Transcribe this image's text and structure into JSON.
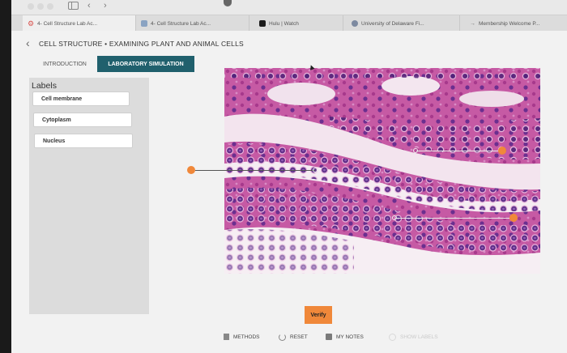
{
  "browser": {
    "tabs": [
      {
        "title": "4- Cell Structure Lab Ac...",
        "favicon": "gear-icon"
      },
      {
        "title": "4- Cell Structure Lab Ac...",
        "favicon": "page-icon"
      },
      {
        "title": "Hulu | Watch",
        "favicon": "hulu-icon"
      },
      {
        "title": "University of Delaware Fi...",
        "favicon": "ud-icon"
      },
      {
        "title": "Membership Welcome P...",
        "favicon": "arrow-icon"
      }
    ]
  },
  "lesson": {
    "title": "CELL STRUCTURE • EXAMINING PLANT AND ANIMAL CELLS",
    "tabs": {
      "intro": "INTRODUCTION",
      "lab": "LABORATORY SIMULATION"
    }
  },
  "labels_panel": {
    "heading": "Labels",
    "items": [
      "Cell membrane",
      "Cytoplasm",
      "Nucleus"
    ]
  },
  "actions": {
    "verify": "Verify"
  },
  "footer": {
    "methods": "METHODS",
    "reset": "RESET",
    "notes": "MY NOTES",
    "show_labels": "SHOW LABELS"
  },
  "colors": {
    "accent_teal": "#20606d",
    "pin_orange": "#f0883a",
    "stain_pink": "#c65aa4",
    "nucleus_purple": "#5a2a86"
  }
}
